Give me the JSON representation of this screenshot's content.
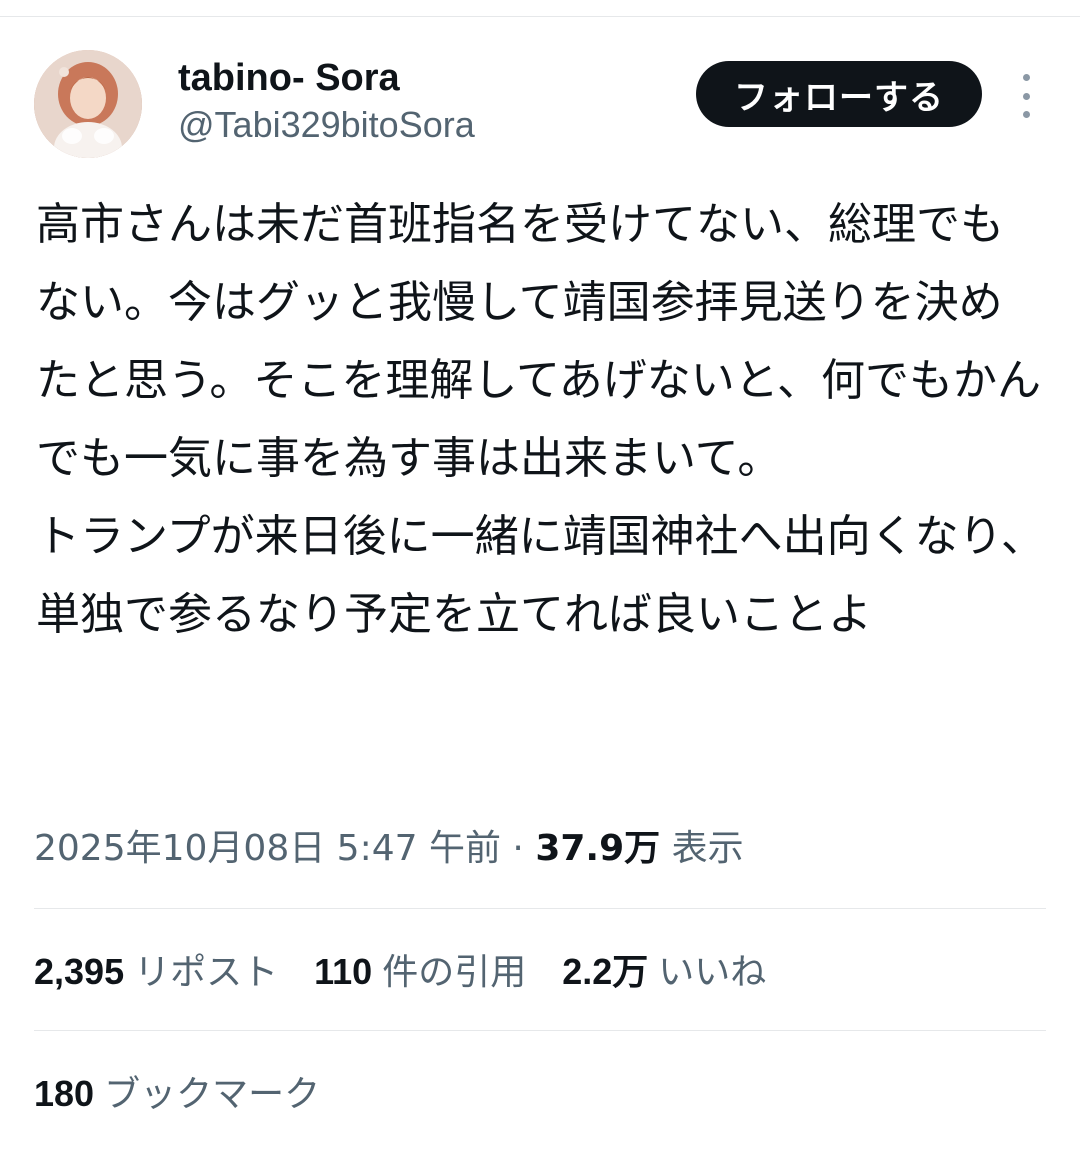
{
  "user": {
    "display_name": "tabino- Sora",
    "handle": "@Tabi329bitoSora",
    "avatar_icon": "profile-photo"
  },
  "actions": {
    "follow_label": "フォローする",
    "more_icon": "vertical-ellipsis-icon"
  },
  "tweet": {
    "text": "高市さんは未だ首班指名を受けてない、総理でもない。今はグッと我慢して靖国参拝見送りを決めたと思う。そこを理解してあげないと、何でもかんでも一気に事を為す事は出来まいて。\nトランプが来日後に一緒に靖国神社へ出向くなり、単独で参るなり予定を立てれば良いことよ"
  },
  "meta": {
    "timestamp": "2025年10月08日 5:47 午前",
    "separator": " · ",
    "views_count": "37.9万",
    "views_label": "表示"
  },
  "stats": {
    "reposts": {
      "count": "2,395",
      "label": "リポスト"
    },
    "quotes": {
      "count": "110",
      "label": "件の引用"
    },
    "likes": {
      "count": "2.2万",
      "label": "いいね"
    },
    "bookmarks": {
      "count": "180",
      "label": "ブックマーク"
    }
  },
  "colors": {
    "text_primary": "#0f1419",
    "text_secondary": "#536471",
    "divider": "#e6e8ea",
    "button_bg": "#0f1419",
    "button_text": "#ffffff"
  }
}
